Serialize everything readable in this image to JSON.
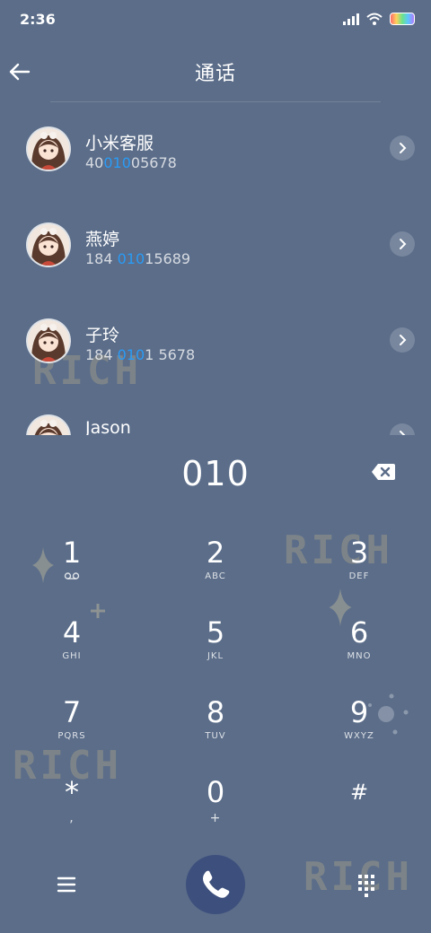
{
  "status_bar": {
    "time": "2:36"
  },
  "header": {
    "title": "通话"
  },
  "contacts": [
    {
      "name": "小米客服",
      "number_pre": "40",
      "number_match": "010",
      "number_post": "05678"
    },
    {
      "name": "燕婷",
      "number_pre": "184 ",
      "number_match": "010",
      "number_post": "15689"
    },
    {
      "name": "子玲",
      "number_pre": "184 ",
      "number_match": "010",
      "number_post": "1 5678"
    },
    {
      "name": "Jason",
      "number_pre": "",
      "number_match": "",
      "number_post": ""
    }
  ],
  "dialer": {
    "input": "010"
  },
  "keypad": [
    {
      "digit": "1",
      "letters": ""
    },
    {
      "digit": "2",
      "letters": "ABC"
    },
    {
      "digit": "3",
      "letters": "DEF"
    },
    {
      "digit": "4",
      "letters": "GHI"
    },
    {
      "digit": "5",
      "letters": "JKL"
    },
    {
      "digit": "6",
      "letters": "MNO"
    },
    {
      "digit": "7",
      "letters": "PQRS"
    },
    {
      "digit": "8",
      "letters": "TUV"
    },
    {
      "digit": "9",
      "letters": "WXYZ"
    },
    {
      "digit": "*",
      "letters": ","
    },
    {
      "digit": "0",
      "letters": "+"
    },
    {
      "digit": "#",
      "letters": ""
    }
  ],
  "watermark": "RICH",
  "colors": {
    "background": "#5b6d89",
    "highlight": "#2a9bf5",
    "call_button": "#3d4f7c"
  }
}
